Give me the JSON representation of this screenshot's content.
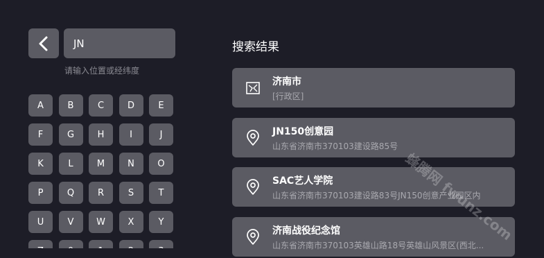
{
  "search": {
    "value": "JN",
    "hint": "请输入位置或经纬度"
  },
  "keyboard": {
    "keys": [
      "A",
      "B",
      "C",
      "D",
      "E",
      "F",
      "G",
      "H",
      "I",
      "J",
      "K",
      "L",
      "M",
      "N",
      "O",
      "P",
      "Q",
      "R",
      "S",
      "T",
      "U",
      "V",
      "W",
      "X",
      "Y",
      "Z",
      "0",
      "1",
      "2",
      "3"
    ]
  },
  "results": {
    "title": "搜索结果",
    "items": [
      {
        "name": "济南市",
        "sub": "[行政区]",
        "icon": "region-icon"
      },
      {
        "name": "JN150创意园",
        "sub": "山东省济南市370103建设路85号",
        "icon": "location-pin-icon"
      },
      {
        "name": "SAC艺人学院",
        "sub": "山东省济南市370103建设路83号JN150创意产业园区内",
        "icon": "location-pin-icon"
      },
      {
        "name": "济南战役纪念馆",
        "sub": "山东省济南市370103英雄山路18号英雄山风景区(西北...",
        "icon": "location-pin-icon"
      }
    ]
  },
  "watermark": {
    "text": "蜂腾网 fwunz.com"
  },
  "colors": {
    "background": "#1d1d27",
    "surface": "#5b5b63",
    "secondary_text": "#a9a9af"
  }
}
